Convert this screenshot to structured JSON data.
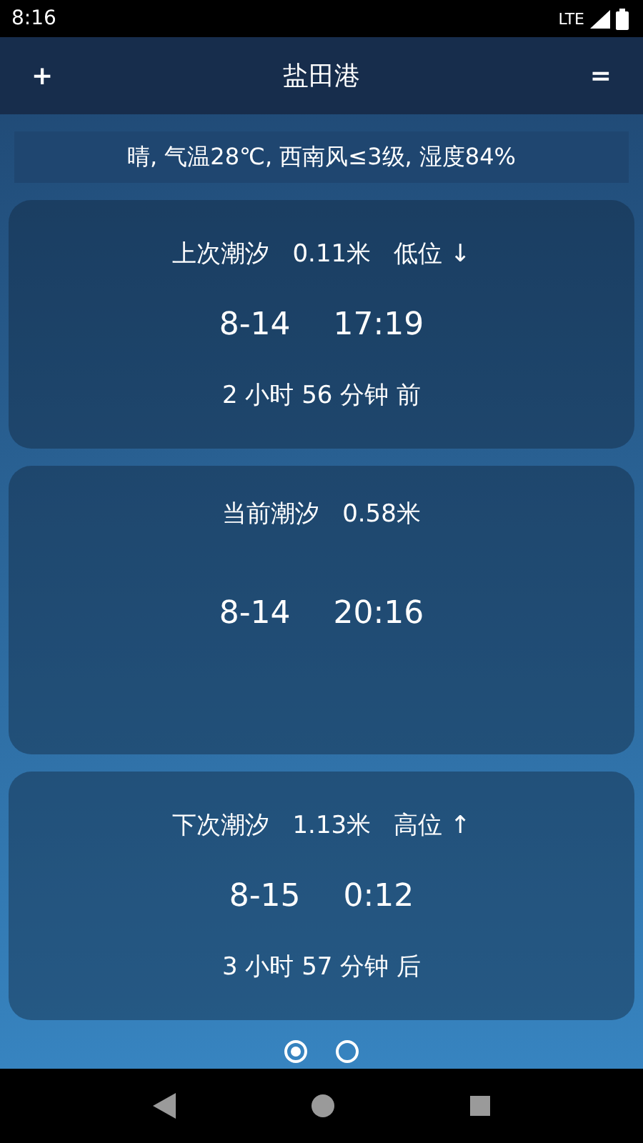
{
  "status_bar": {
    "time": "8:16",
    "network": "LTE"
  },
  "header": {
    "add": "+",
    "title": "盐田港",
    "menu": "="
  },
  "weather": "晴, 气温28℃, 西南风≤3级, 湿度84%",
  "tides": [
    {
      "label": "上次潮汐",
      "height": "0.11米",
      "state": "低位 ↓",
      "date": "8-14",
      "time": "17:19",
      "relative": "2 小时 56 分钟 前"
    },
    {
      "label": "当前潮汐",
      "height": "0.58米",
      "date": "8-14",
      "time": "20:16"
    },
    {
      "label": "下次潮汐",
      "height": "1.13米",
      "state": "高位 ↑",
      "date": "8-15",
      "time": "0:12",
      "relative": "3 小时 57 分钟 后"
    }
  ],
  "pages": [
    {
      "selected": true
    },
    {
      "selected": false
    }
  ]
}
